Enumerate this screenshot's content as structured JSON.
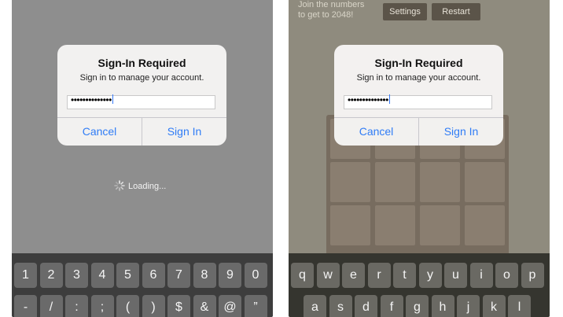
{
  "left_screen": {
    "dialog": {
      "title": "Sign-In Required",
      "message": "Sign in to manage your account.",
      "password_value": "••••••••••••••",
      "cancel_label": "Cancel",
      "sign_in_label": "Sign In"
    },
    "loading_text": "Loading...",
    "keyboard": {
      "row1": [
        "1",
        "2",
        "3",
        "4",
        "5",
        "6",
        "7",
        "8",
        "9",
        "0"
      ],
      "row2": [
        "-",
        "/",
        ":",
        ";",
        "(",
        ")",
        "$",
        "&",
        "@",
        "”"
      ]
    }
  },
  "right_screen": {
    "game": {
      "intro_text": "Join the numbers\nto get to 2048!",
      "settings_label": "Settings",
      "restart_label": "Restart"
    },
    "dialog": {
      "title": "Sign-In Required",
      "message": "Sign in to manage your account.",
      "password_value": "••••••••••••••",
      "cancel_label": "Cancel",
      "sign_in_label": "Sign In"
    },
    "keyboard": {
      "row1": [
        "q",
        "w",
        "e",
        "r",
        "t",
        "y",
        "u",
        "i",
        "o",
        "p"
      ],
      "row2": [
        "a",
        "s",
        "d",
        "f",
        "g",
        "h",
        "j",
        "k",
        "l"
      ]
    }
  },
  "colors": {
    "accent": "#2f7cf6",
    "caret": "#3478f6"
  },
  "icons": {
    "spinner": "spinner-icon"
  }
}
